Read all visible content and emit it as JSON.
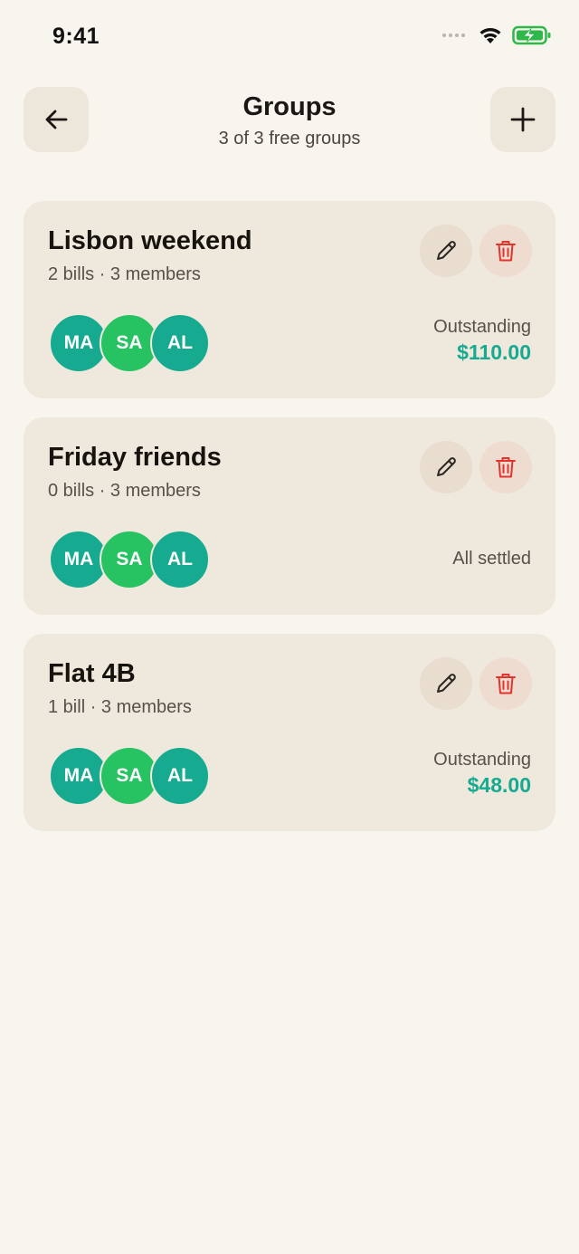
{
  "status_bar": {
    "time": "9:41"
  },
  "header": {
    "title": "Groups",
    "subtitle": "3 of 3 free groups",
    "back_icon": "arrow-left-icon",
    "add_icon": "plus-icon"
  },
  "colors": {
    "background": "#f8f5ef",
    "card": "#efe8dc",
    "accent_teal": "#16ab90",
    "accent_green": "#27c262",
    "delete_red": "#e0342c"
  },
  "groups": [
    {
      "name": "Lisbon weekend",
      "meta": "2 bills · 3 members",
      "members": [
        "MA",
        "SA",
        "AL"
      ],
      "balance_label": "Outstanding",
      "balance_amount": "$110.00",
      "status": ""
    },
    {
      "name": "Friday friends",
      "meta": "0 bills · 3 members",
      "members": [
        "MA",
        "SA",
        "AL"
      ],
      "balance_label": "",
      "balance_amount": "",
      "status": "All settled"
    },
    {
      "name": "Flat 4B",
      "meta": "1 bill · 3 members",
      "members": [
        "MA",
        "SA",
        "AL"
      ],
      "balance_label": "Outstanding",
      "balance_amount": "$48.00",
      "status": ""
    }
  ]
}
